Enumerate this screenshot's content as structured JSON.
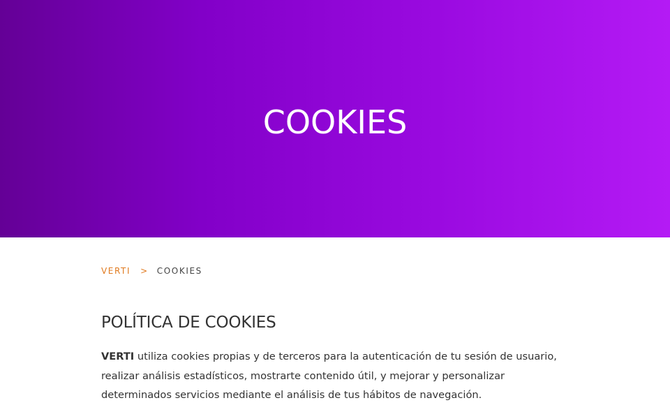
{
  "hero": {
    "title": "COOKIES"
  },
  "breadcrumb": {
    "home_label": "VERTI",
    "separator": ">",
    "current_label": "COOKIES"
  },
  "main": {
    "section_title": "POLÍTICA DE COOKIES",
    "paragraph_brand": "VERTI",
    "paragraph_text": " utiliza cookies propias y de terceros para la autenticación de tu sesión de usuario, realizar análisis estadísticos, mostrarte contenido útil, y mejorar y personalizar determinados servicios mediante el análisis de tus hábitos de navegación."
  },
  "colors": {
    "hero_gradient_start": "#640096",
    "hero_gradient_end": "#b41af5",
    "breadcrumb_accent": "#e07a1f",
    "text": "#333333"
  }
}
